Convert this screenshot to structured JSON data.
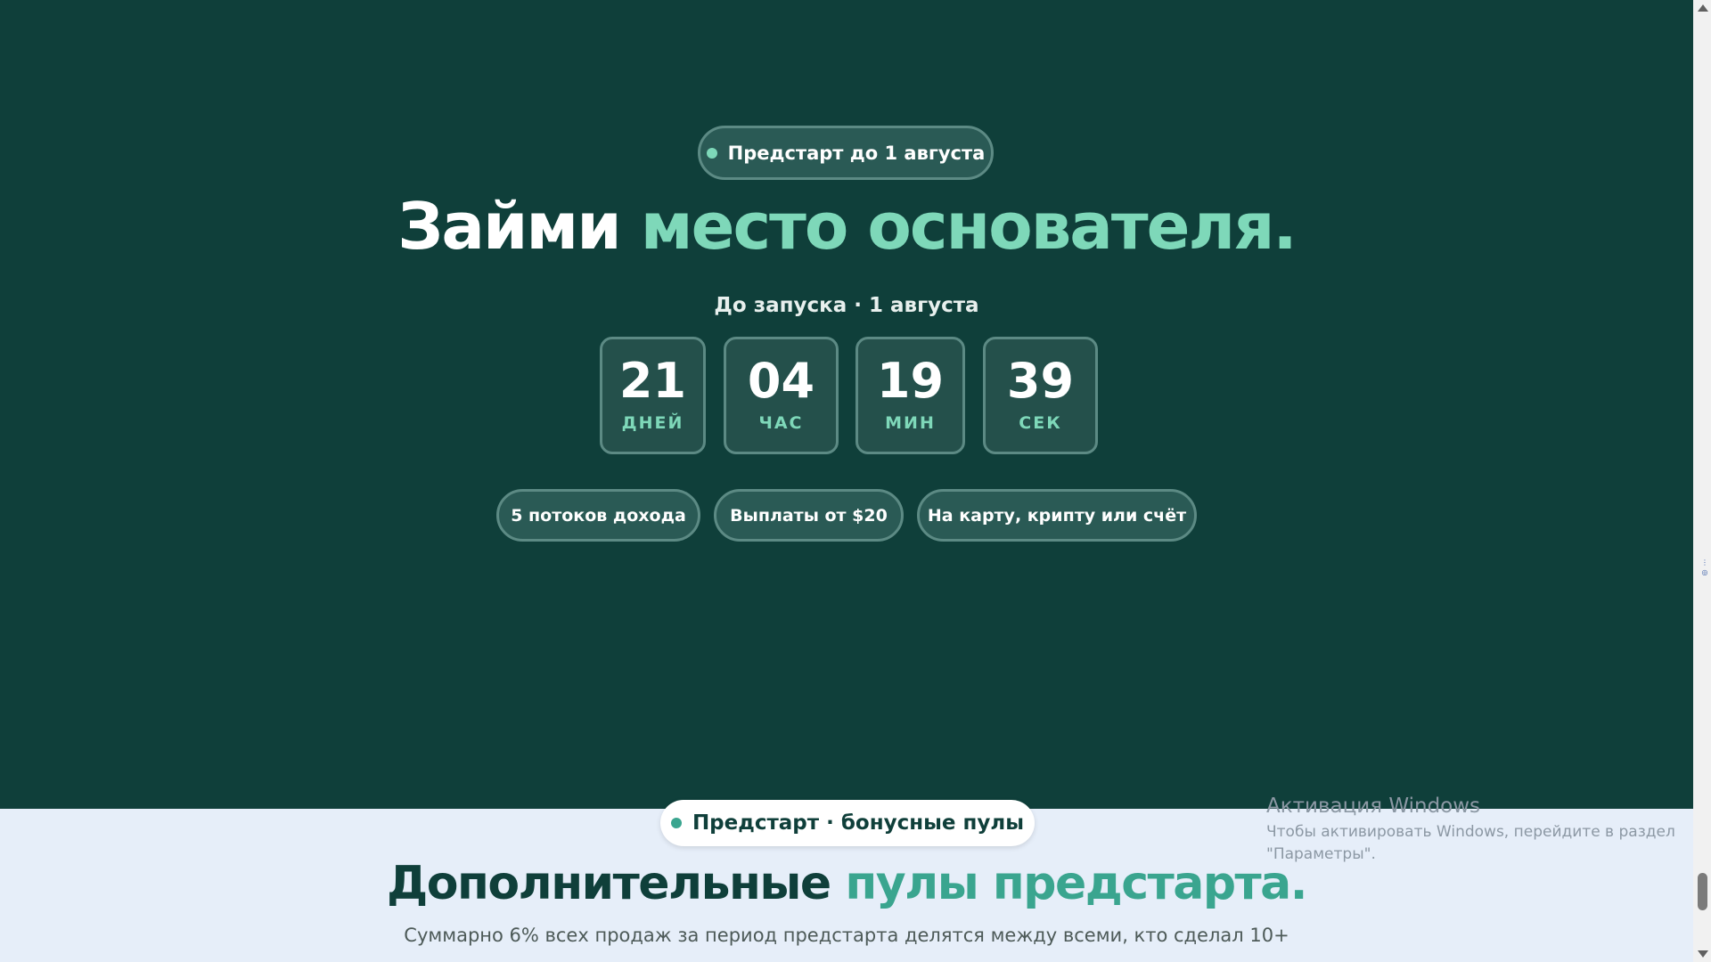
{
  "hero": {
    "badge": "Предстарт до 1 августа",
    "title_start": "Займи ",
    "title_accent": "место основателя.",
    "countdown_caption": "До запуска · 1 августа",
    "countdown": [
      {
        "value": "21",
        "label": "ДНЕЙ"
      },
      {
        "value": "04",
        "label": "ЧАС"
      },
      {
        "value": "19",
        "label": "МИН"
      },
      {
        "value": "39",
        "label": "СЕК"
      }
    ],
    "chips": [
      "5 потоков дохода",
      "Выплаты от $20",
      "На карту, крипту или счёт"
    ]
  },
  "bonus": {
    "badge": "Предстарт · бонусные пулы",
    "title_start": "Дополнительные ",
    "title_accent": "пулы предстарта.",
    "description": "Суммарно 6% всех продаж за период предстарта делятся между всеми, кто сделал 10+"
  },
  "windows_watermark": {
    "title": "Активация Windows",
    "line1": "Чтобы активировать Windows, перейдите в раздел",
    "line2": "\"Параметры\"."
  },
  "colors": {
    "hero_bg": "#0f3f3a",
    "accent": "#7ed8b9",
    "accent_dark": "#3aa58f",
    "light_bg": "#e6eef9"
  }
}
